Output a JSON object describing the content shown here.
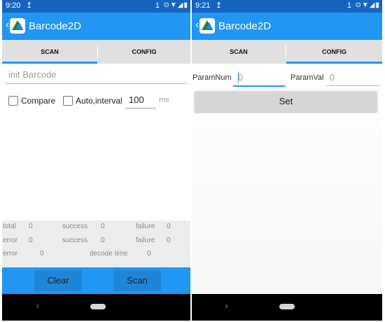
{
  "colors": {
    "accent": "#2196f3",
    "statusbar": "#1565c0",
    "nav": "#000000",
    "tab_bg": "#e0e0e0",
    "stats_bg": "#ececec"
  },
  "left": {
    "status": {
      "time": "9:20",
      "upload_icon": "↥",
      "notif_count": "1",
      "icons": "⊙▼◢▮"
    },
    "app_title": "Barcode2D",
    "tabs": [
      "SCAN",
      "CONFIG"
    ],
    "init_placeholder": "init Barcode",
    "compare_label": "Compare",
    "auto_label": "Auto,interval",
    "interval_value": "100",
    "interval_unit": "ms",
    "stats": {
      "row1": {
        "total_label": "total",
        "total": "0",
        "success_label": "success",
        "success": "0",
        "failure_label": "failure",
        "failure": "0"
      },
      "row2": {
        "error_label": "error",
        "error": "0",
        "success_label": "success",
        "success": "0",
        "failure_label": "failure",
        "failure": "0"
      },
      "row3": {
        "error_label": "error",
        "error": "0",
        "decode_label": "decode time",
        "decode": "0"
      }
    },
    "clear_label": "Clear",
    "scan_label": "Scan",
    "nav_back": "‹"
  },
  "right": {
    "status": {
      "time": "9:21",
      "upload_icon": "↥",
      "notif_count": "1",
      "icons": "⊙▼◢▮"
    },
    "app_title": "Barcode2D",
    "tabs": [
      "SCAN",
      "CONFIG"
    ],
    "param_num_label": "ParamNum",
    "param_num_value": "0",
    "param_val_label": "ParamVal",
    "param_val_value": "0",
    "set_label": "Set",
    "nav_back": "‹"
  }
}
